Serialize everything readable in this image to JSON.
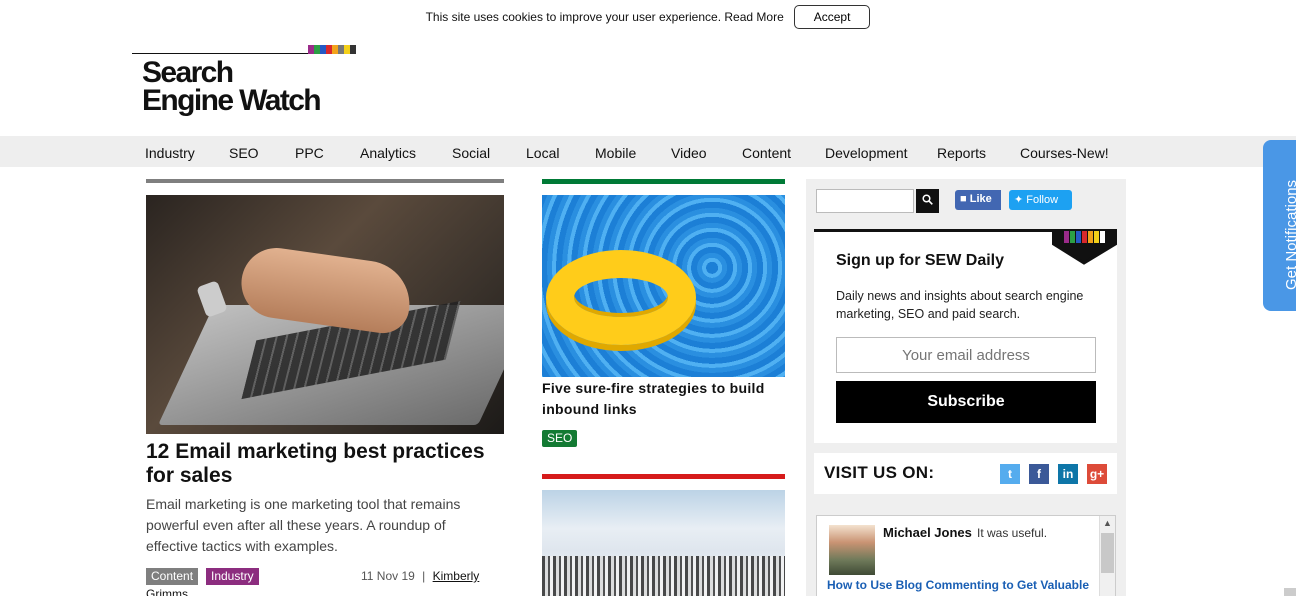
{
  "cookie": {
    "text": "This site uses cookies to improve your user experience.",
    "read_more": "Read More",
    "accept": "Accept"
  },
  "logo": {
    "line1": "Search",
    "line2": "Engine Watch",
    "bar_colors": [
      "#9b2b8a",
      "#2c9f45",
      "#2559c5",
      "#d8282c",
      "#f2a31b",
      "#777777",
      "#f4d019",
      "#333333"
    ]
  },
  "nav": [
    "Industry",
    "SEO",
    "PPC",
    "Analytics",
    "Social",
    "Local",
    "Mobile",
    "Video",
    "Content",
    "Development",
    "Reports",
    "Courses-New!"
  ],
  "left_article": {
    "title": "12 Email marketing best practices for sales",
    "description": "Email marketing is one marketing tool that remains powerful even after all these years. A roundup of effective tactics with examples.",
    "tags": [
      {
        "label": "Content",
        "color": "#7f7f7f"
      },
      {
        "label": "Industry",
        "color": "#8c2d7f"
      }
    ],
    "date": "11 Nov 19",
    "separator": "|",
    "author_first": "Kimberly",
    "author_last": "Grimms"
  },
  "middle": {
    "article1": {
      "title": "Five sure-fire strategies to build inbound links",
      "tag": "SEO",
      "tag_color": "#137a33",
      "bar_color": "#007a36"
    },
    "article2": {
      "bar_color": "#d61b1b"
    }
  },
  "sidebar": {
    "search_placeholder": "",
    "facebook": "Like",
    "twitter": "Follow",
    "signup": {
      "title": "Sign up for SEW Daily",
      "description": "Daily news and insights about search engine marketing, SEO and paid search.",
      "placeholder": "Your email address",
      "button": "Subscribe"
    },
    "visit_label": "VISIT US ON:",
    "social": [
      {
        "icon": "twitter-icon",
        "glyph": "t",
        "color": "#55acee"
      },
      {
        "icon": "facebook-icon",
        "glyph": "f",
        "color": "#3b5998"
      },
      {
        "icon": "linkedin-icon",
        "glyph": "in",
        "color": "#0e76a8"
      },
      {
        "icon": "google-plus-icon",
        "glyph": "g+",
        "color": "#dd4b39"
      }
    ],
    "comment": {
      "name": "Michael Jones",
      "text": "It was useful.",
      "link": "How to Use Blog Commenting to Get Valuable"
    }
  },
  "notifications": "Get Notifications"
}
